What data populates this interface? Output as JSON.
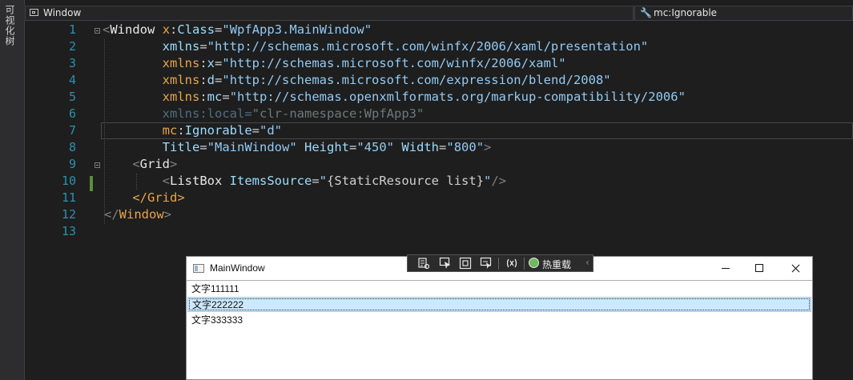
{
  "side_panel": {
    "label": "可视化树"
  },
  "navbar": {
    "left_label": "Window",
    "right_icon": "wrench-icon",
    "right_label": "mc:Ignorable"
  },
  "editor": {
    "lines": [
      {
        "num": "1"
      },
      {
        "num": "2"
      },
      {
        "num": "3"
      },
      {
        "num": "4"
      },
      {
        "num": "5"
      },
      {
        "num": "6"
      },
      {
        "num": "7"
      },
      {
        "num": "8"
      },
      {
        "num": "9"
      },
      {
        "num": "10"
      },
      {
        "num": "11"
      },
      {
        "num": "12"
      },
      {
        "num": "13"
      }
    ],
    "code": {
      "l1": {
        "lt": "<",
        "el": "Window",
        "ns": "x",
        "colon": ":",
        "attr": "Class",
        "eq": "=",
        "val": "\"WpfApp3.MainWindow\""
      },
      "l2": {
        "attr": "xmlns",
        "eq": "=",
        "val": "\"http://schemas.microsoft.com/winfx/2006/xaml/presentation\""
      },
      "l3": {
        "ns": "xmlns",
        "colon": ":",
        "attr": "x",
        "eq": "=",
        "val": "\"http://schemas.microsoft.com/winfx/2006/xaml\""
      },
      "l4": {
        "ns": "xmlns",
        "colon": ":",
        "attr": "d",
        "eq": "=",
        "val": "\"http://schemas.microsoft.com/expression/blend/2008\""
      },
      "l5": {
        "ns": "xmlns",
        "colon": ":",
        "attr": "mc",
        "eq": "=",
        "val": "\"http://schemas.openxmlformats.org/markup-compatibility/2006\""
      },
      "l6": {
        "ns": "xmlns",
        "colon": ":",
        "attr": "local",
        "eq": "=",
        "val": "\"clr-namespace:WpfApp3\""
      },
      "l7": {
        "ns": "mc",
        "colon": ":",
        "attr": "Ignorable",
        "eq": "=",
        "val": "\"d\""
      },
      "l8": {
        "a1": "Title",
        "v1": "\"MainWindow\"",
        "a2": "Height",
        "v2": "\"450\"",
        "a3": "Width",
        "v3": "\"800\"",
        "end": ">",
        "eq": "="
      },
      "l9": {
        "lt": "<",
        "el": "Grid",
        "gt": ">"
      },
      "l10": {
        "lt": "<",
        "el": "ListBox",
        "attr": "ItemsSource",
        "eq": "=",
        "q1": "\"",
        "ob": "{",
        "ext": "StaticResource",
        "sp": " ",
        "ref": "list",
        "cb": "}",
        "q2": "\"",
        "end": "/>"
      },
      "l11": {
        "lt": "</",
        "el": "Grid",
        "gt": ">"
      },
      "l12": {
        "lt": "</",
        "el": "Window",
        "gt": ">"
      }
    }
  },
  "app_window": {
    "title": "MainWindow",
    "items": [
      "文字111111",
      "文字222222",
      "文字333333"
    ],
    "selected_index": 1
  },
  "debug_toolbar": {
    "hot_reload_label": "热重载",
    "chevron": "‹"
  }
}
